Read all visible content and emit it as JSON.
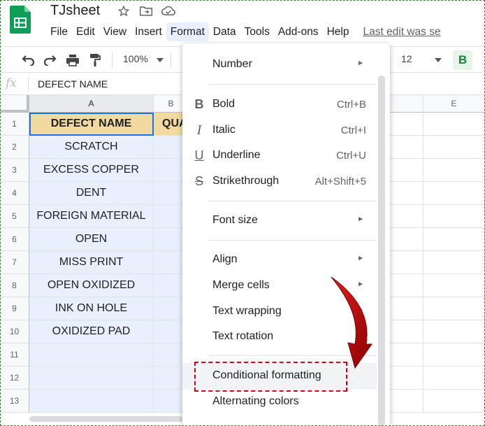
{
  "app": {
    "title": "TJsheet",
    "menus": [
      "File",
      "Edit",
      "View",
      "Insert",
      "Format",
      "Data",
      "Tools",
      "Add-ons",
      "Help"
    ],
    "active_menu": "Format",
    "last_edit": "Last edit was se"
  },
  "toolbar": {
    "zoom": "100%",
    "font_size": "12",
    "bold_label": "B",
    "icons": [
      "undo-icon",
      "redo-icon",
      "print-icon",
      "paint-format-icon",
      "chevron-down-icon"
    ]
  },
  "formula_bar": {
    "fx": "fx",
    "value": "DEFECT NAME"
  },
  "grid": {
    "columns": [
      "A",
      "B",
      "E"
    ],
    "rows": [
      "1",
      "2",
      "3",
      "4",
      "5",
      "6",
      "7",
      "8",
      "9",
      "10",
      "11",
      "12",
      "13"
    ],
    "col_a": [
      "DEFECT NAME",
      "SCRATCH",
      "EXCESS COPPER",
      "DENT",
      "FOREIGN MATERIAL",
      "OPEN",
      "MISS PRINT",
      "OPEN OXIDIZED",
      "INK ON HOLE",
      "OXIDIZED PAD",
      "",
      "",
      ""
    ],
    "col_b_header": "QUA"
  },
  "format_menu": {
    "items": [
      {
        "label": "Number",
        "submenu": true
      },
      {
        "label": "Bold",
        "icon": "B",
        "shortcut": "Ctrl+B"
      },
      {
        "label": "Italic",
        "icon": "I",
        "shortcut": "Ctrl+I"
      },
      {
        "label": "Underline",
        "icon": "U",
        "shortcut": "Ctrl+U"
      },
      {
        "label": "Strikethrough",
        "icon": "S",
        "shortcut": "Alt+Shift+5"
      },
      {
        "label": "Font size",
        "submenu": true
      },
      {
        "label": "Align",
        "submenu": true
      },
      {
        "label": "Merge cells",
        "submenu": true
      },
      {
        "label": "Text wrapping",
        "submenu": true
      },
      {
        "label": "Text rotation",
        "submenu": true
      },
      {
        "label": "Conditional formatting"
      },
      {
        "label": "Alternating colors"
      }
    ],
    "submenu_arrow": "►"
  },
  "annotation": {
    "highlight_color": "#d0021b",
    "arrow_color": "#c00000"
  }
}
